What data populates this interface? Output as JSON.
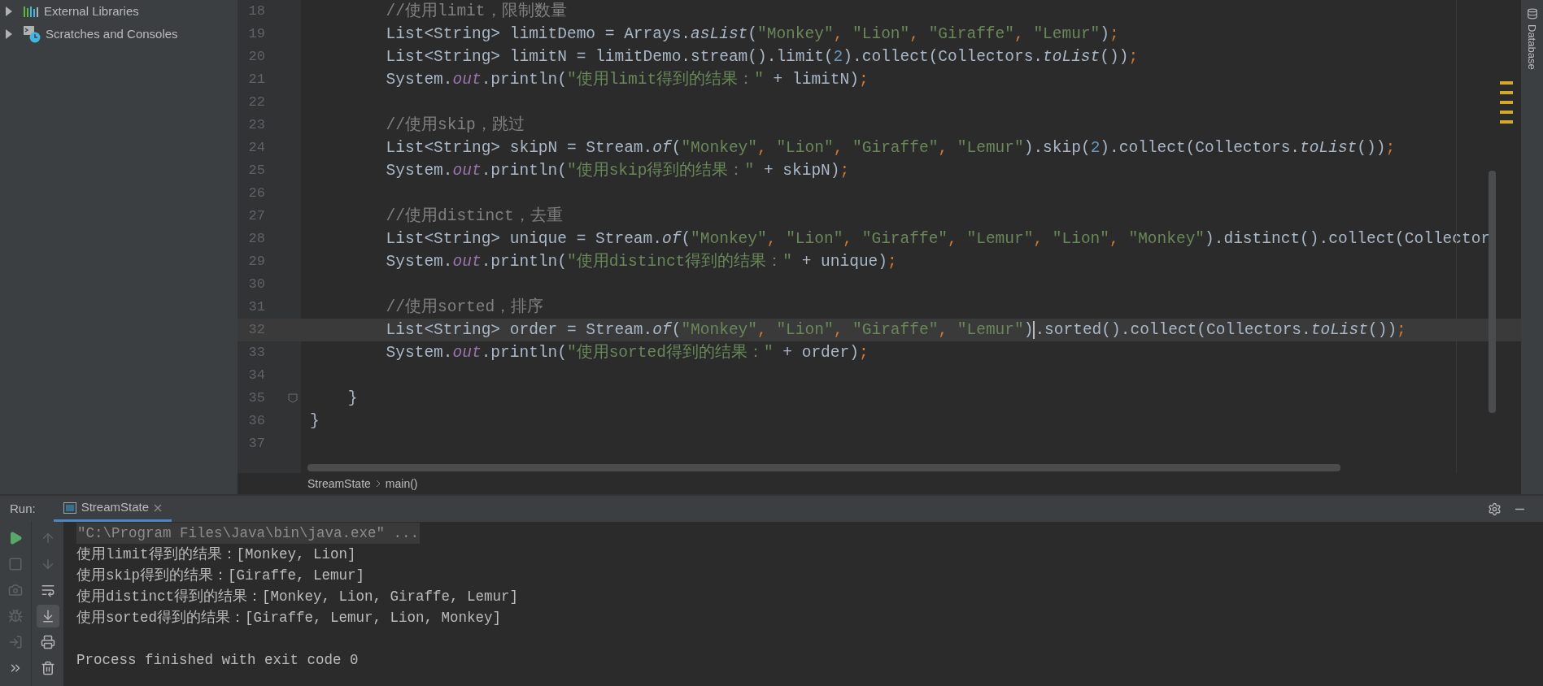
{
  "project_tree": [
    {
      "label": "External Libraries",
      "expanded": false
    },
    {
      "label": "Scratches and Consoles",
      "expanded": false
    }
  ],
  "editor": {
    "lines": [
      {
        "number": "18",
        "current": false,
        "tokens": [
          {
            "kind": "comment",
            "t": "        //使用limit，限制数量"
          }
        ]
      },
      {
        "number": "19",
        "current": false,
        "tokens": [
          {
            "kind": "plain",
            "t": "        List<String> limitDemo = Arrays."
          },
          {
            "kind": "static",
            "t": "asList"
          },
          {
            "kind": "plain",
            "t": "("
          },
          {
            "kind": "str",
            "t": "\"Monkey\""
          },
          {
            "kind": "punct",
            "t": ", "
          },
          {
            "kind": "str",
            "t": "\"Lion\""
          },
          {
            "kind": "punct",
            "t": ", "
          },
          {
            "kind": "str",
            "t": "\"Giraffe\""
          },
          {
            "kind": "punct",
            "t": ", "
          },
          {
            "kind": "str",
            "t": "\"Lemur\""
          },
          {
            "kind": "plain",
            "t": ")"
          },
          {
            "kind": "punct",
            "t": ";"
          }
        ]
      },
      {
        "number": "20",
        "current": false,
        "tokens": [
          {
            "kind": "plain",
            "t": "        List<String> limitN = limitDemo.stream().limit("
          },
          {
            "kind": "num",
            "t": "2"
          },
          {
            "kind": "plain",
            "t": ").collect(Collectors."
          },
          {
            "kind": "static",
            "t": "toList"
          },
          {
            "kind": "plain",
            "t": "())"
          },
          {
            "kind": "punct",
            "t": ";"
          }
        ]
      },
      {
        "number": "21",
        "current": false,
        "tokens": [
          {
            "kind": "plain",
            "t": "        System."
          },
          {
            "kind": "field",
            "t": "out"
          },
          {
            "kind": "plain",
            "t": ".println("
          },
          {
            "kind": "str",
            "t": "\"使用limit得到的结果：\""
          },
          {
            "kind": "plain",
            "t": " + limitN)"
          },
          {
            "kind": "punct",
            "t": ";"
          }
        ]
      },
      {
        "number": "22",
        "current": false
      },
      {
        "number": "23",
        "current": false,
        "tokens": [
          {
            "kind": "comment",
            "t": "        //使用skip，跳过"
          }
        ]
      },
      {
        "number": "24",
        "current": false,
        "tokens": [
          {
            "kind": "plain",
            "t": "        List<String> skipN = Stream."
          },
          {
            "kind": "static",
            "t": "of"
          },
          {
            "kind": "plain",
            "t": "("
          },
          {
            "kind": "str",
            "t": "\"Monkey\""
          },
          {
            "kind": "punct",
            "t": ", "
          },
          {
            "kind": "str",
            "t": "\"Lion\""
          },
          {
            "kind": "punct",
            "t": ", "
          },
          {
            "kind": "str",
            "t": "\"Giraffe\""
          },
          {
            "kind": "punct",
            "t": ", "
          },
          {
            "kind": "str",
            "t": "\"Lemur\""
          },
          {
            "kind": "plain",
            "t": ").skip("
          },
          {
            "kind": "num",
            "t": "2"
          },
          {
            "kind": "plain",
            "t": ").collect(Collectors."
          },
          {
            "kind": "static",
            "t": "toList"
          },
          {
            "kind": "plain",
            "t": "())"
          },
          {
            "kind": "punct",
            "t": ";"
          }
        ]
      },
      {
        "number": "25",
        "current": false,
        "tokens": [
          {
            "kind": "plain",
            "t": "        System."
          },
          {
            "kind": "field",
            "t": "out"
          },
          {
            "kind": "plain",
            "t": ".println("
          },
          {
            "kind": "str",
            "t": "\"使用skip得到的结果：\""
          },
          {
            "kind": "plain",
            "t": " + skipN)"
          },
          {
            "kind": "punct",
            "t": ";"
          }
        ]
      },
      {
        "number": "26",
        "current": false
      },
      {
        "number": "27",
        "current": false,
        "tokens": [
          {
            "kind": "comment",
            "t": "        //使用distinct，去重"
          }
        ]
      },
      {
        "number": "28",
        "current": false,
        "tokens": [
          {
            "kind": "plain",
            "t": "        List<String> unique = Stream."
          },
          {
            "kind": "static",
            "t": "of"
          },
          {
            "kind": "plain",
            "t": "("
          },
          {
            "kind": "str",
            "t": "\"Monkey\""
          },
          {
            "kind": "punct",
            "t": ", "
          },
          {
            "kind": "str",
            "t": "\"Lion\""
          },
          {
            "kind": "punct",
            "t": ", "
          },
          {
            "kind": "str",
            "t": "\"Giraffe\""
          },
          {
            "kind": "punct",
            "t": ", "
          },
          {
            "kind": "str",
            "t": "\"Lemur\""
          },
          {
            "kind": "punct",
            "t": ", "
          },
          {
            "kind": "str",
            "t": "\"Lion\""
          },
          {
            "kind": "punct",
            "t": ", "
          },
          {
            "kind": "str",
            "t": "\"Monkey\""
          },
          {
            "kind": "plain",
            "t": ").distinct().collect(Collector"
          }
        ]
      },
      {
        "number": "29",
        "current": false,
        "tokens": [
          {
            "kind": "plain",
            "t": "        System."
          },
          {
            "kind": "field",
            "t": "out"
          },
          {
            "kind": "plain",
            "t": ".println("
          },
          {
            "kind": "str",
            "t": "\"使用distinct得到的结果：\""
          },
          {
            "kind": "plain",
            "t": " + unique)"
          },
          {
            "kind": "punct",
            "t": ";"
          }
        ]
      },
      {
        "number": "30",
        "current": false
      },
      {
        "number": "31",
        "current": false,
        "tokens": [
          {
            "kind": "comment",
            "t": "        //使用sorted，排序"
          }
        ]
      },
      {
        "number": "32",
        "current": true,
        "tokens": [
          {
            "kind": "plain",
            "t": "        List<String> order = Stream."
          },
          {
            "kind": "static",
            "t": "of"
          },
          {
            "kind": "plain",
            "t": "("
          },
          {
            "kind": "str",
            "t": "\"Monkey\""
          },
          {
            "kind": "punct",
            "t": ", "
          },
          {
            "kind": "str",
            "t": "\"Lion\""
          },
          {
            "kind": "punct",
            "t": ", "
          },
          {
            "kind": "str",
            "t": "\"Giraffe\""
          },
          {
            "kind": "punct",
            "t": ", "
          },
          {
            "kind": "str",
            "t": "\"Lemur\""
          },
          {
            "kind": "plain",
            "t": ")",
            "caret": true
          },
          {
            "kind": "plain",
            "t": ".sorted().collect(Collectors."
          },
          {
            "kind": "static",
            "t": "toList"
          },
          {
            "kind": "plain",
            "t": "())"
          },
          {
            "kind": "punct",
            "t": ";"
          }
        ]
      },
      {
        "number": "33",
        "current": false,
        "tokens": [
          {
            "kind": "plain",
            "t": "        System."
          },
          {
            "kind": "field",
            "t": "out"
          },
          {
            "kind": "plain",
            "t": ".println("
          },
          {
            "kind": "str",
            "t": "\"使用sorted得到的结果：\""
          },
          {
            "kind": "plain",
            "t": " + order)"
          },
          {
            "kind": "punct",
            "t": ";"
          }
        ]
      },
      {
        "number": "34",
        "current": false
      },
      {
        "number": "35",
        "current": false,
        "fold": true,
        "tokens": [
          {
            "kind": "plain",
            "t": "    }"
          }
        ]
      },
      {
        "number": "36",
        "current": false,
        "tokens": [
          {
            "kind": "plain",
            "t": "}"
          }
        ]
      },
      {
        "number": "37",
        "current": false
      }
    ]
  },
  "breadcrumbs": [
    "StreamState",
    "main()"
  ],
  "right_tool": {
    "label": "Database"
  },
  "run": {
    "label": "Run:",
    "tab": {
      "label": "StreamState",
      "selected": true
    },
    "left_tools": [
      {
        "kind": "play",
        "disabled": false
      },
      {
        "kind": "stop",
        "disabled": true
      },
      {
        "kind": "camera",
        "disabled": true
      },
      {
        "kind": "bug",
        "disabled": true
      },
      {
        "kind": "exit",
        "disabled": true
      },
      {
        "kind": "more",
        "disabled": false
      }
    ],
    "right_tools": [
      {
        "kind": "up",
        "selected": false,
        "disabled": true
      },
      {
        "kind": "down",
        "selected": false,
        "disabled": true
      },
      {
        "kind": "wrap",
        "selected": false,
        "disabled": false
      },
      {
        "kind": "scroll_end",
        "selected": true,
        "disabled": false
      },
      {
        "kind": "print",
        "selected": false,
        "disabled": false
      },
      {
        "kind": "trash",
        "selected": false,
        "disabled": false
      }
    ],
    "console": [
      {
        "kind": "command",
        "text": "\"C:\\Program Files\\Java\\bin\\java.exe\" ..."
      },
      {
        "kind": "output",
        "text": "使用limit得到的结果：[Monkey, Lion]"
      },
      {
        "kind": "output",
        "text": "使用skip得到的结果：[Giraffe, Lemur]"
      },
      {
        "kind": "output",
        "text": "使用distinct得到的结果：[Monkey, Lion, Giraffe, Lemur]"
      },
      {
        "kind": "output",
        "text": "使用sorted得到的结果：[Giraffe, Lemur, Lion, Monkey]"
      },
      {
        "kind": "blank"
      },
      {
        "kind": "output",
        "text": "Process finished with exit code 0"
      }
    ]
  }
}
